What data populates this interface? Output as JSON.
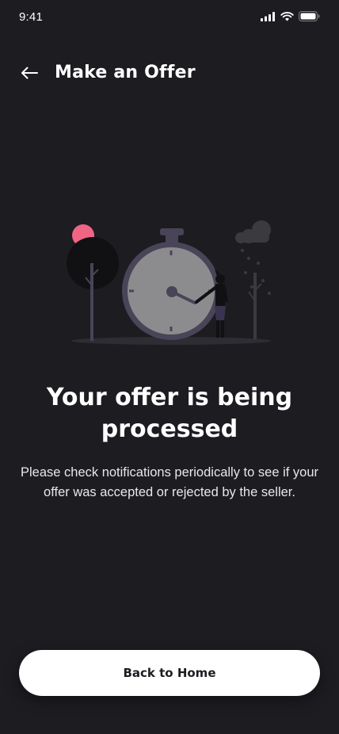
{
  "status_bar": {
    "time": "9:41",
    "icons": [
      "cellular-signal-icon",
      "wifi-icon",
      "battery-icon"
    ]
  },
  "header": {
    "back_icon": "arrow-left-icon",
    "title": "Make an Offer"
  },
  "illustration": {
    "subject": "stopwatch-with-person-icon",
    "colors": {
      "accent_pink": "#f06584",
      "clock_face": "#8c8c8f",
      "clock_rim": "#4a4458",
      "tree_dark": "#111114",
      "cloud": "#3a3a3f"
    }
  },
  "main": {
    "headline": "Your offer is being processed",
    "message": "Please check notifications periodically to see if your offer was accepted or rejected by the seller."
  },
  "footer": {
    "button_label": "Back to Home"
  },
  "colors": {
    "background": "#1c1c21",
    "text": "#ffffff",
    "button_bg": "#ffffff",
    "button_text": "#1c1c21"
  }
}
